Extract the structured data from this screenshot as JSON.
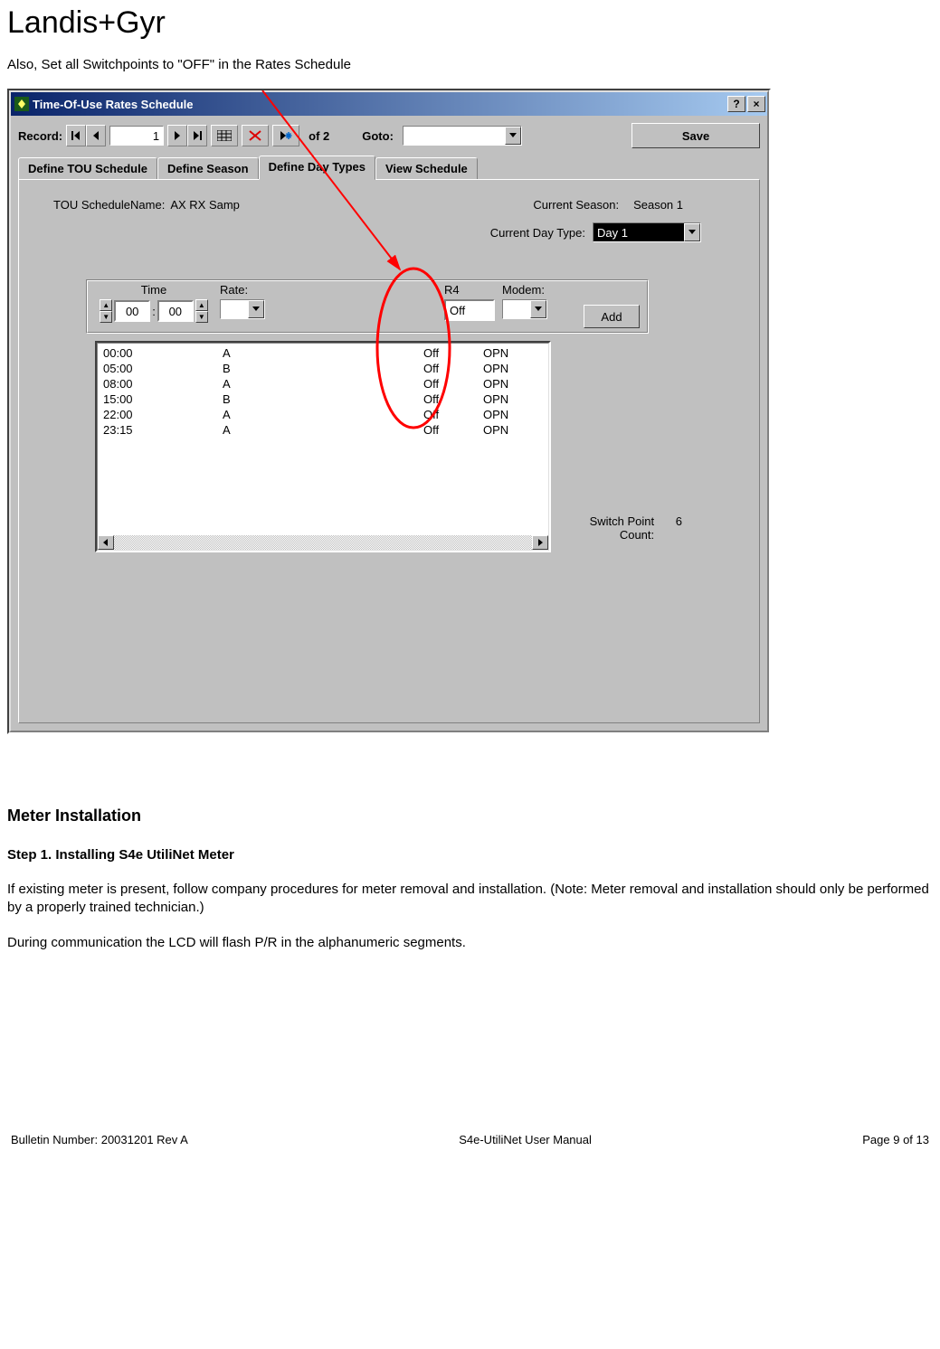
{
  "doc": {
    "brand": "Landis+Gyr",
    "intro": "Also, Set all Switchpoints to \"OFF\" in the Rates Schedule",
    "section_heading": "Meter Installation",
    "step_heading": "Step 1.    Installing S4e UtiliNet Meter",
    "para1": "If existing meter is present, follow company procedures for meter removal and installation. (Note: Meter removal and installation should only be performed by a properly trained technician.)",
    "para2": "During communication the LCD will flash P/R in the alphanumeric segments.",
    "footer_left": "Bulletin Number: 20031201 Rev A",
    "footer_center": "S4e-UtiliNet User Manual",
    "footer_right": "Page 9 of 13"
  },
  "win": {
    "title": "Time-Of-Use Rates Schedule",
    "help_btn": "?",
    "close_btn": "×",
    "toolbar": {
      "record_label": "Record:",
      "record_value": "1",
      "of_text": "of  2",
      "goto_label": "Goto:",
      "goto_value": "",
      "save_label": "Save"
    },
    "tabs": {
      "t0": "Define TOU Schedule",
      "t1": "Define Season",
      "t2": "Define Day Types",
      "t3": "View Schedule",
      "active_index": 2
    },
    "page": {
      "schedule_name_label": "TOU ScheduleName:",
      "schedule_name_value": "AX RX Samp",
      "current_season_label": "Current Season:",
      "current_season_value": "Season 1",
      "current_daytype_label": "Current Day Type:",
      "current_daytype_value": "Day 1",
      "col_time": "Time",
      "col_rate": "Rate:",
      "col_r4": "R4",
      "col_modem": "Modem:",
      "time_hh": "00",
      "time_mm": "00",
      "rate_value": "",
      "r4_value": "Off",
      "modem_value": "",
      "add_label": "Add",
      "switchpoint_label": "Switch Point\nCount:",
      "switchpoint_count": "6",
      "rows": [
        {
          "time": "00:00",
          "rate": "A",
          "r4": "Off",
          "modem": "OPN"
        },
        {
          "time": "05:00",
          "rate": "B",
          "r4": "Off",
          "modem": "OPN"
        },
        {
          "time": "08:00",
          "rate": "A",
          "r4": "Off",
          "modem": "OPN"
        },
        {
          "time": "15:00",
          "rate": "B",
          "r4": "Off",
          "modem": "OPN"
        },
        {
          "time": "22:00",
          "rate": "A",
          "r4": "Off",
          "modem": "OPN"
        },
        {
          "time": "23:15",
          "rate": "A",
          "r4": "Off",
          "modem": "OPN"
        }
      ]
    }
  }
}
